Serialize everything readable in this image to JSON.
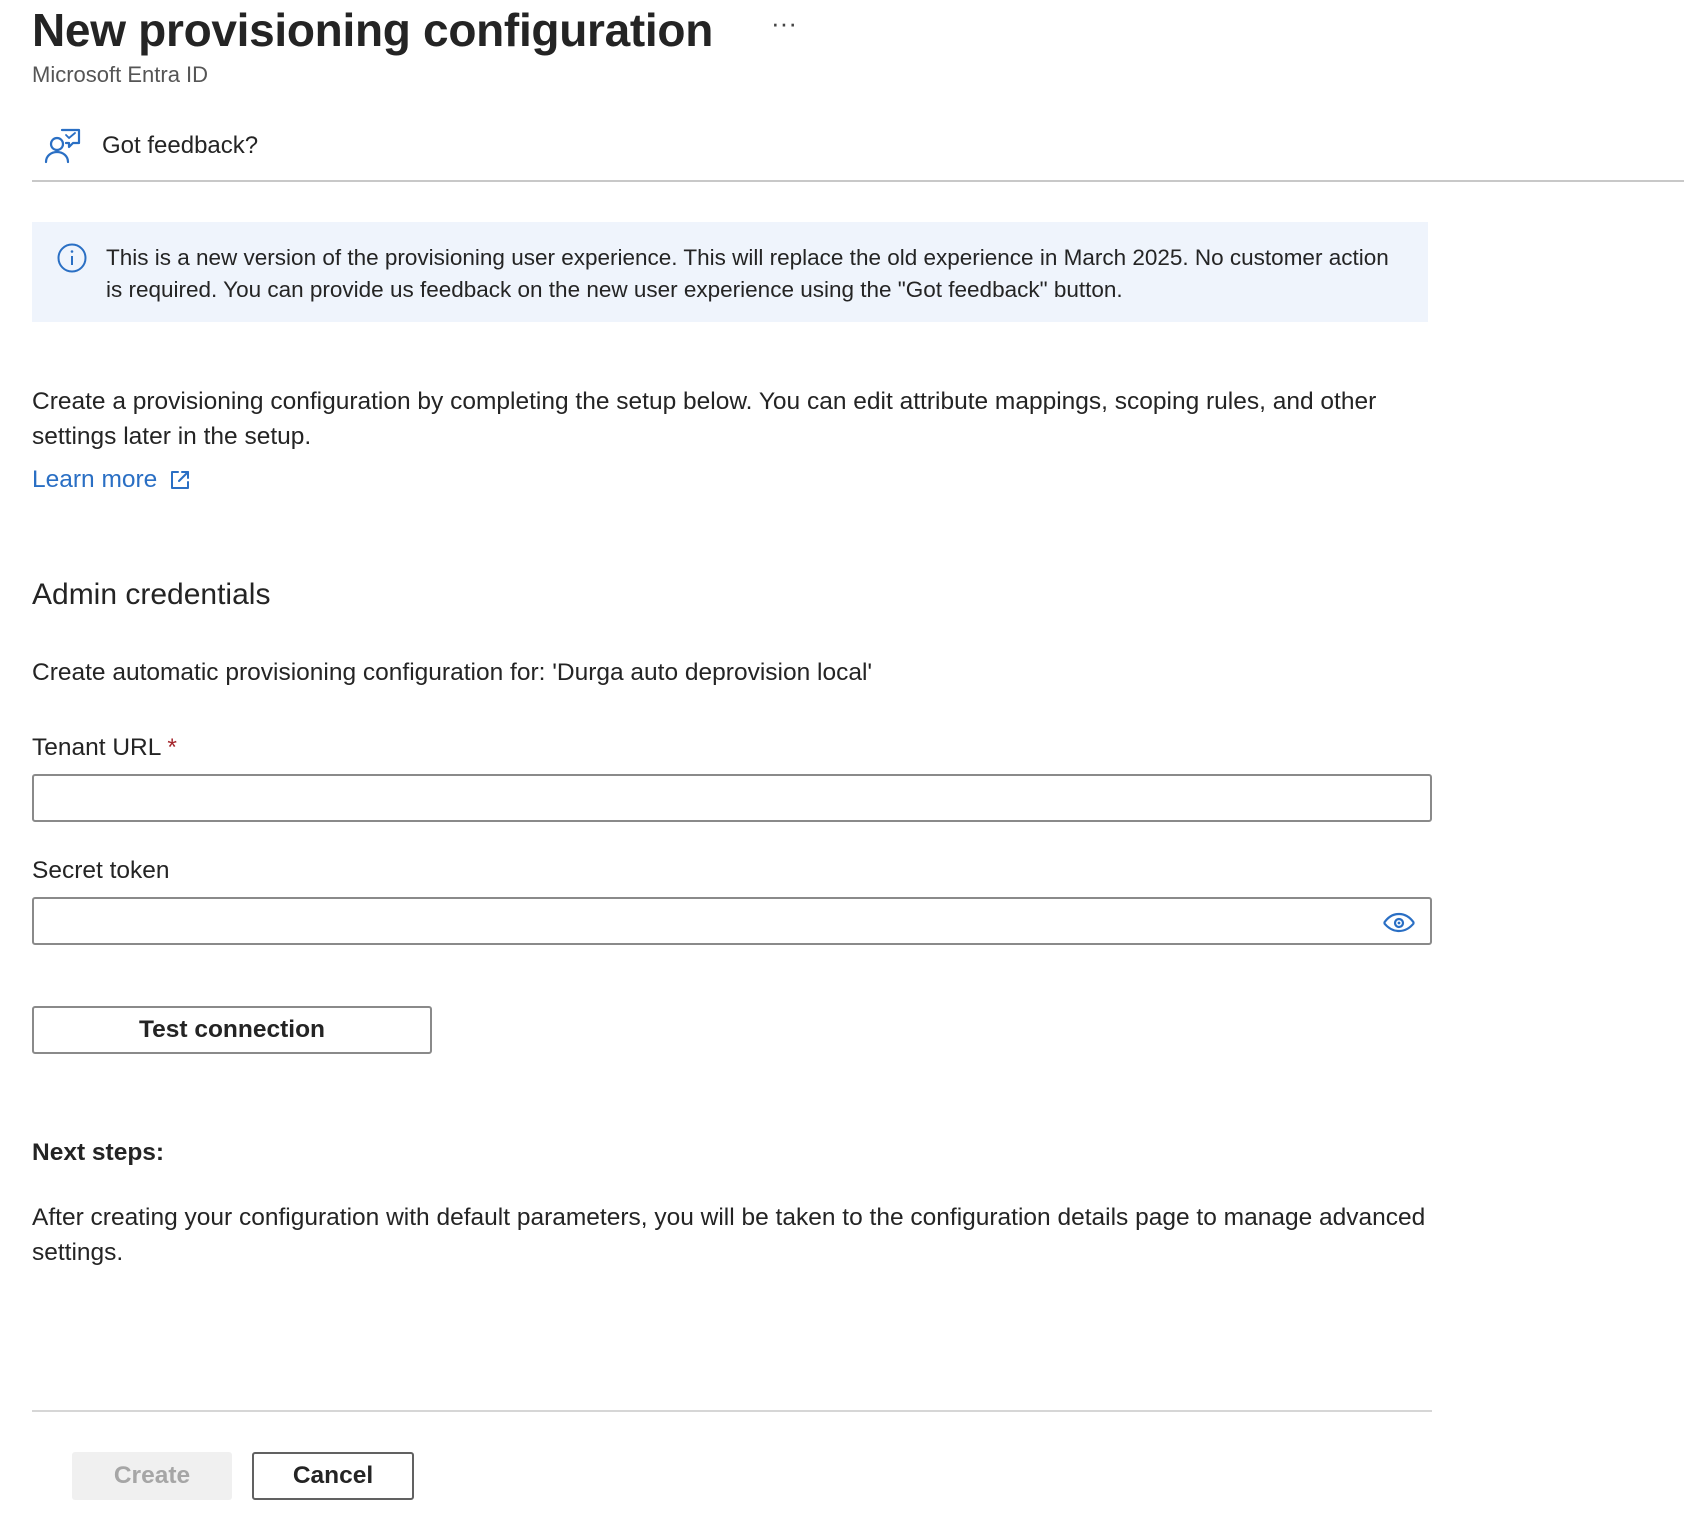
{
  "header": {
    "title": "New provisioning configuration",
    "more_label": "···",
    "subtitle": "Microsoft Entra ID"
  },
  "toolbar": {
    "feedback_label": "Got feedback?",
    "feedback_icon": "feedback-person-icon"
  },
  "banner": {
    "icon": "info-icon",
    "text": "This is a new version of the provisioning user experience. This will replace the old experience in March 2025. No customer action is required. You can provide us feedback on the new user experience using the \"Got feedback\" button."
  },
  "intro": {
    "text": "Create a provisioning configuration by completing the setup below. You can edit attribute mappings, scoping rules, and other settings later in the setup.",
    "learn_more_label": "Learn more",
    "learn_more_icon": "external-link-icon"
  },
  "credentials": {
    "heading": "Admin credentials",
    "config_for": "Create automatic provisioning configuration for: 'Durga auto deprovision local'",
    "tenant_url": {
      "label": "Tenant URL",
      "required_marker": "*",
      "value": "",
      "placeholder": ""
    },
    "secret_token": {
      "label": "Secret token",
      "value": "",
      "placeholder": "",
      "reveal_icon": "eye-icon"
    },
    "test_button_label": "Test connection"
  },
  "next_steps": {
    "heading": "Next steps:",
    "text": "After creating your configuration with default parameters, you will be taken to the configuration details page to manage advanced settings."
  },
  "footer": {
    "create_label": "Create",
    "cancel_label": "Cancel"
  },
  "colors": {
    "accent": "#2a6fc4",
    "banner_bg": "#eff4fc",
    "required": "#a4262c"
  }
}
